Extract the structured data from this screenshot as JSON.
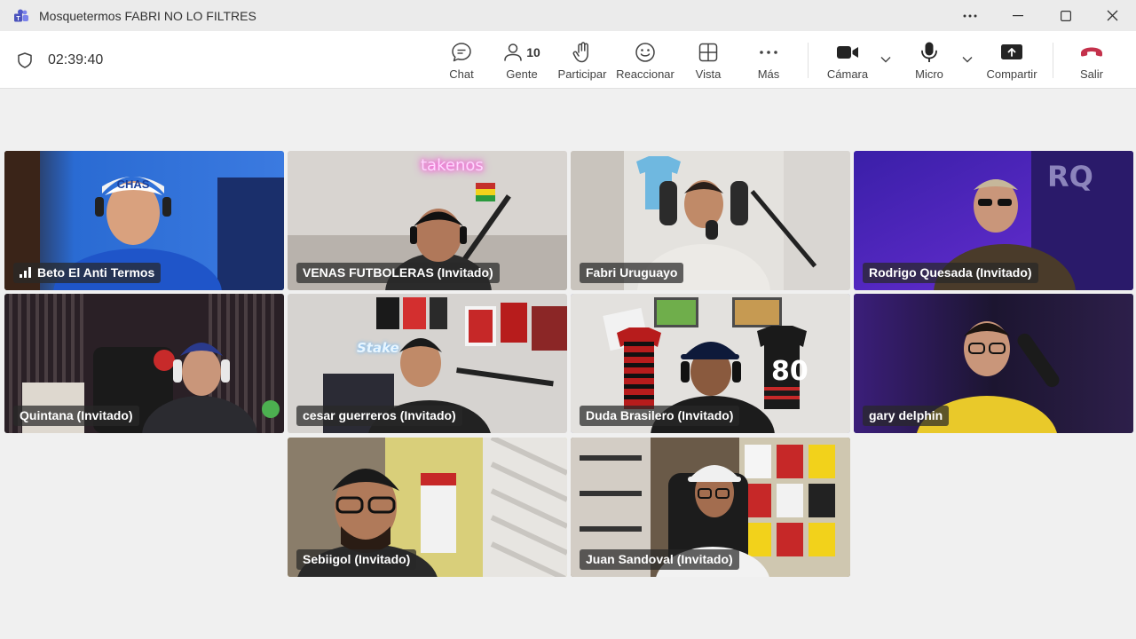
{
  "window": {
    "title": "Mosquetermos FABRI NO LO FILTRES",
    "controls": [
      "more-options",
      "minimize",
      "maximize",
      "close"
    ]
  },
  "toolbar": {
    "timer": "02:39:40",
    "buttons": {
      "chat": "Chat",
      "people": "Gente",
      "people_count": "10",
      "raise_hand": "Participar",
      "react": "Reaccionar",
      "view": "Vista",
      "more": "Más",
      "camera": "Cámara",
      "mic": "Micro",
      "share": "Compartir",
      "leave": "Salir"
    },
    "leave_color": "#c4314b"
  },
  "participants": [
    {
      "name": "Beto El Anti Termos",
      "speaking_signal": true,
      "active": false
    },
    {
      "name": "VENAS FUTBOLERAS (Invitado)",
      "overlay_text": "takenos",
      "active": false
    },
    {
      "name": "Fabri Uruguayo",
      "active": false
    },
    {
      "name": "Rodrigo Quesada (Invitado)",
      "overlay_text": "RQ",
      "active": false
    },
    {
      "name": "Quintana (Invitado)",
      "active": false
    },
    {
      "name": "cesar guerreros (Invitado)",
      "overlay_text": "Stake",
      "active": false
    },
    {
      "name": "Duda Brasilero (Invitado)",
      "overlay_text": "80",
      "active": true
    },
    {
      "name": "gary delphin",
      "active": true
    },
    {
      "name": "Sebiigol (Invitado)",
      "active": false
    },
    {
      "name": "Juan Sandoval (Invitado)",
      "active": false
    }
  ],
  "accent_color": "#7b83d6"
}
